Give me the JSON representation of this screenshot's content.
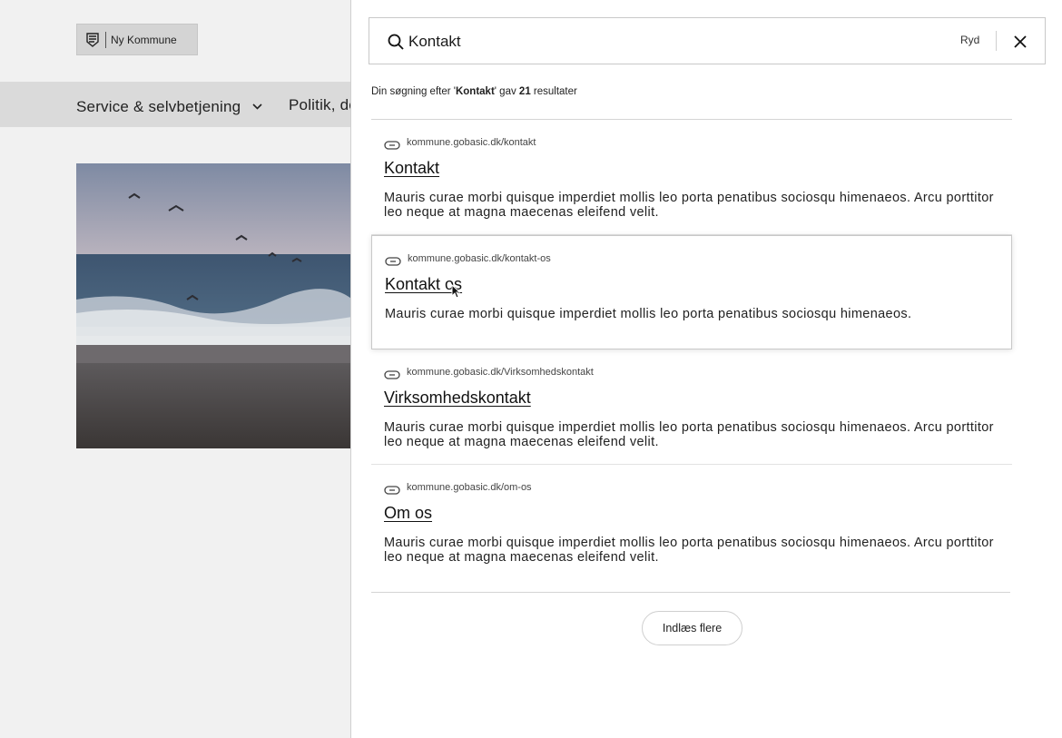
{
  "site": {
    "logo_text": "Ny Kommune",
    "logo_icon": "crest-icon"
  },
  "nav": {
    "items": [
      {
        "label": "Service & selvbetjening",
        "icon": "chevron-down-icon"
      },
      {
        "label": "Politik, de"
      }
    ]
  },
  "search": {
    "value": "Kontakt",
    "placeholder": "",
    "clear_label": "Ryd",
    "summary_prefix": "Din søgning efter '",
    "summary_query": "Kontakt",
    "summary_mid": "' gav ",
    "summary_count": "21",
    "summary_suffix": " resultater"
  },
  "results": [
    {
      "url": "kommune.gobasic.dk/kontakt",
      "title": "Kontakt",
      "description": "Mauris curae morbi quisque imperdiet mollis leo porta penatibus sociosqu himenaeos. Arcu porttitor leo neque at magna maecenas eleifend velit."
    },
    {
      "url": "kommune.gobasic.dk/kontakt-os",
      "title": "Kontakt os",
      "description": "Mauris curae morbi quisque imperdiet mollis leo porta penatibus sociosqu himenaeos."
    },
    {
      "url": "kommune.gobasic.dk/Virksomhedskontakt",
      "title": "Virksomhedskontakt",
      "description": "Mauris curae morbi quisque imperdiet mollis leo porta penatibus sociosqu himenaeos. Arcu porttitor leo neque at magna maecenas eleifend velit."
    },
    {
      "url": "kommune.gobasic.dk/om-os",
      "title": "Om os",
      "description": "Mauris curae morbi quisque imperdiet mollis leo porta penatibus sociosqu himenaeos. Arcu porttitor leo neque at magna maecenas eleifend velit."
    }
  ],
  "load_more_label": "Indlæs flere",
  "colors": {
    "panel_bg": "#ffffff",
    "page_bg": "#f1f1f1",
    "nav_bg": "#dadada",
    "text": "#1a1a1a",
    "border": "#c8c8c8"
  }
}
